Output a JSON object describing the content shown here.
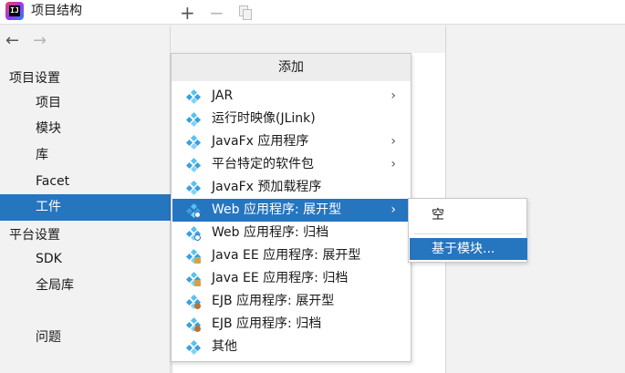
{
  "window": {
    "title": "项目结构",
    "app_icon": "intellij-idea-icon",
    "app_icon_text": "IJ"
  },
  "nav": {
    "back_icon": "←",
    "forward_icon": "→"
  },
  "sidebar": {
    "project_settings_header": "项目设置",
    "project_items": [
      "项目",
      "模块",
      "库",
      "Facet",
      "工件"
    ],
    "selected": "工件",
    "platform_settings_header": "平台设置",
    "platform_items": [
      "SDK",
      "全局库"
    ],
    "problems": "问题"
  },
  "toolbar": {
    "add": "+",
    "remove": "−"
  },
  "add_menu": {
    "title": "添加",
    "items": [
      {
        "label": "JAR",
        "submenu": true,
        "icon": "artifact-icon"
      },
      {
        "label": "运行时映像(JLink)",
        "submenu": false,
        "icon": "artifact-icon"
      },
      {
        "label": "JavaFx 应用程序",
        "submenu": true,
        "icon": "artifact-icon"
      },
      {
        "label": "平台特定的软件包",
        "submenu": true,
        "icon": "artifact-icon"
      },
      {
        "label": "JavaFx 预加载程序",
        "submenu": false,
        "icon": "artifact-icon"
      },
      {
        "label": "Web 应用程序: 展开型",
        "submenu": true,
        "icon": "web-artifact-icon",
        "highlighted": true
      },
      {
        "label": "Web 应用程序: 归档",
        "submenu": false,
        "icon": "web-artifact-icon"
      },
      {
        "label": "Java EE 应用程序: 展开型",
        "submenu": false,
        "icon": "javaee-artifact-icon"
      },
      {
        "label": "Java EE 应用程序: 归档",
        "submenu": false,
        "icon": "javaee-artifact-icon"
      },
      {
        "label": "EJB 应用程序: 展开型",
        "submenu": false,
        "icon": "ejb-artifact-icon"
      },
      {
        "label": "EJB 应用程序: 归档",
        "submenu": false,
        "icon": "ejb-artifact-icon"
      },
      {
        "label": "其他",
        "submenu": false,
        "icon": "artifact-icon"
      }
    ]
  },
  "submenu": {
    "empty": "空",
    "from_module": "基于模块..."
  },
  "colors": {
    "selection": "#2675bf",
    "menu_header_bg": "#ededed",
    "pane_bg": "#f2f2f2"
  }
}
